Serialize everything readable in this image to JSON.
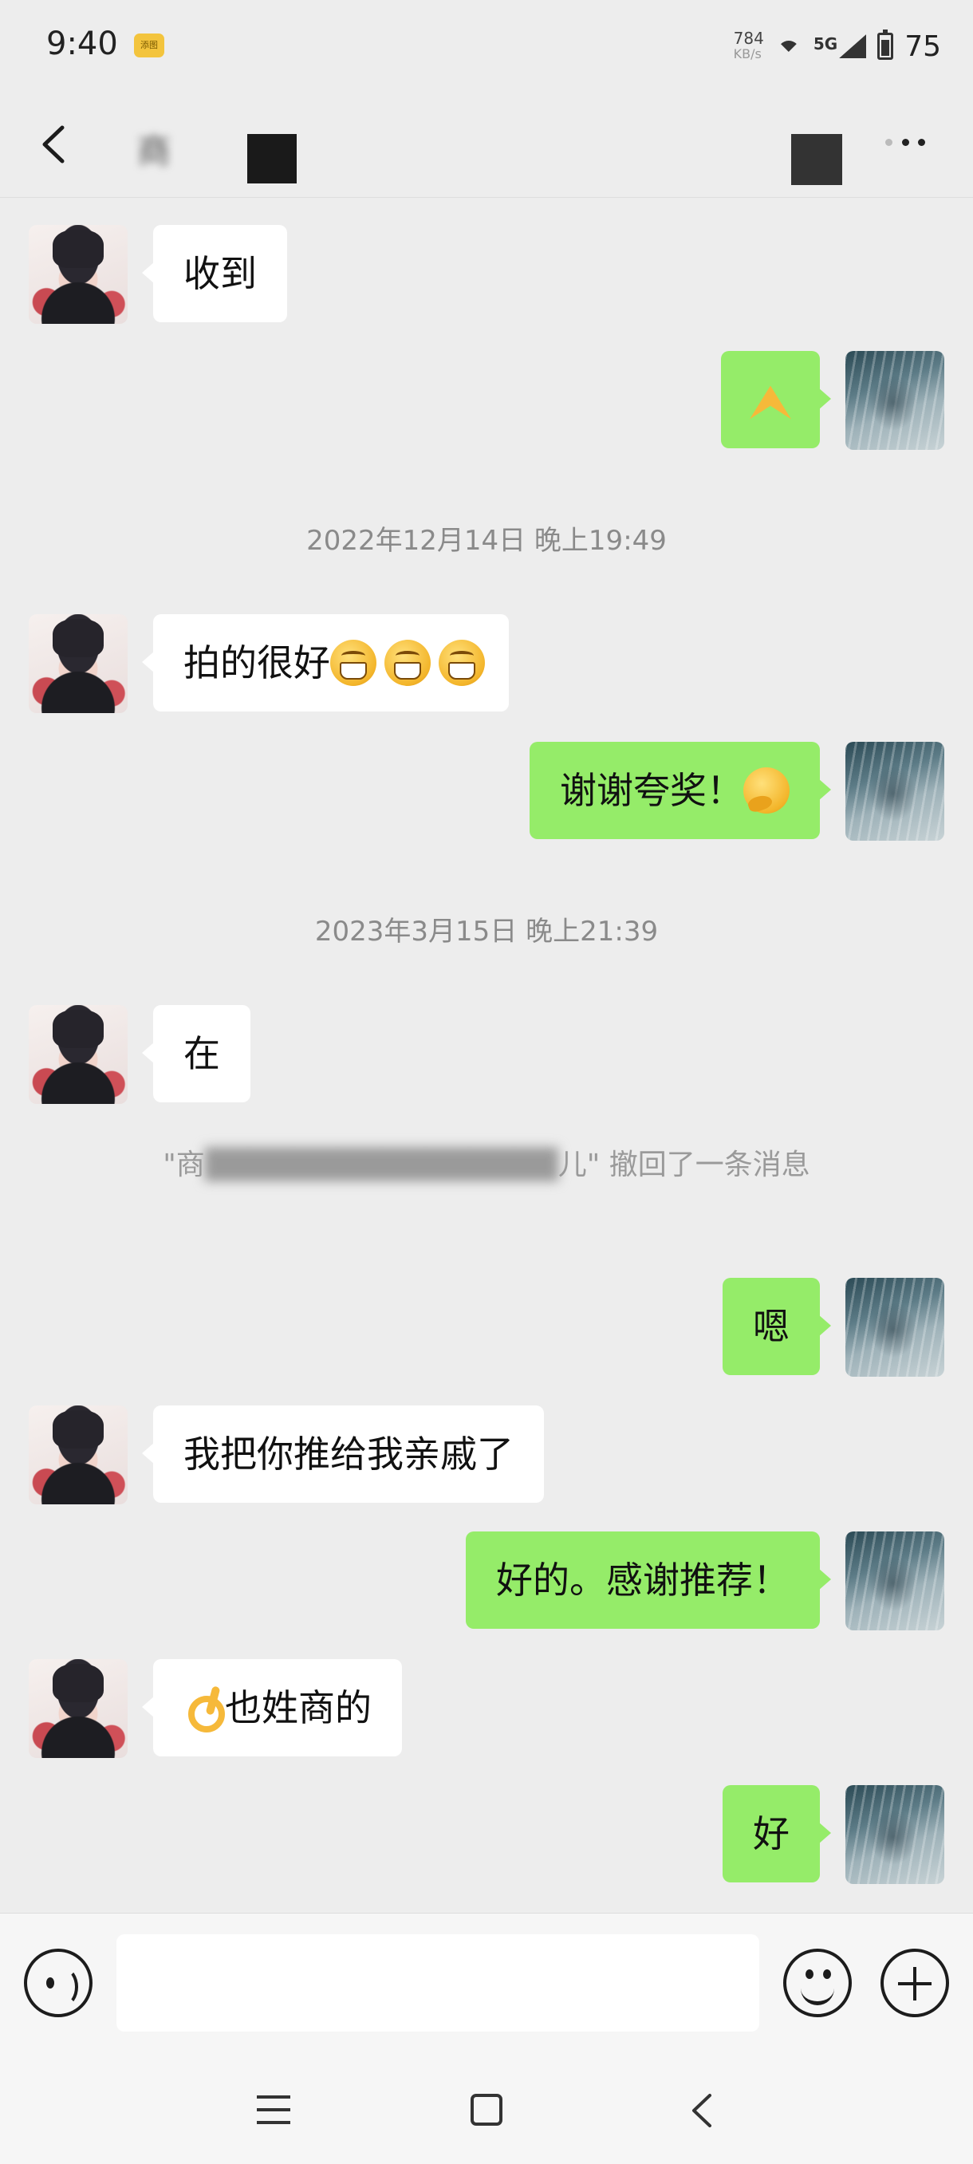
{
  "status_bar": {
    "time": "9:40",
    "badge_text": "添图",
    "net_speed": "784",
    "net_speed_unit": "KB/s",
    "network": "5G",
    "battery": "75"
  },
  "header": {
    "title": "商"
  },
  "messages": [
    {
      "side": "left",
      "text": "收到"
    },
    {
      "side": "right",
      "icon": "hand-gesture-emoji"
    },
    {
      "type": "time",
      "text": "2022年12月14日 晚上19:49"
    },
    {
      "side": "left",
      "text": "拍的很好",
      "icons": [
        "grinning-emoji",
        "grinning-emoji",
        "grinning-emoji"
      ]
    },
    {
      "side": "right",
      "text": "谢谢夸奖！",
      "icons": [
        "thinking-emoji"
      ]
    },
    {
      "type": "time",
      "text": "2023年3月15日 晚上21:39"
    },
    {
      "side": "left",
      "text": "在"
    },
    {
      "type": "system",
      "name": "\"商",
      "name_end": "儿\"",
      "text": "撤回了一条消息"
    },
    {
      "side": "right",
      "text": "嗯"
    },
    {
      "side": "left",
      "text": "我把你推给我亲戚了"
    },
    {
      "side": "right",
      "text": "好的。感谢推荐！"
    },
    {
      "side": "left",
      "text": "也姓商的",
      "icons": [
        "ok-hand-emoji"
      ]
    },
    {
      "side": "right",
      "text": "好"
    }
  ],
  "input": {
    "value": "",
    "placeholder": ""
  },
  "colors": {
    "background": "#ededed",
    "bubble_self": "#95ec69",
    "bubble_other": "#ffffff",
    "timestamp": "#8a8a8a"
  }
}
